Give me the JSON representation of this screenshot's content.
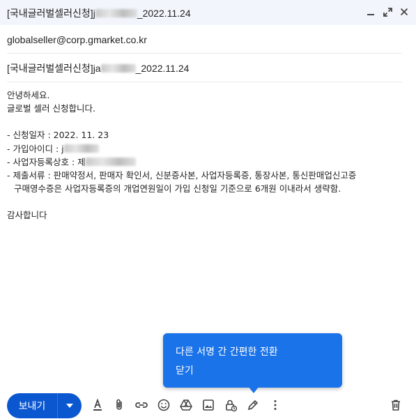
{
  "window": {
    "title_prefix": "[국내글러벌셀러신청]j",
    "title_suffix": "_2022.11.24"
  },
  "compose": {
    "to": "globalseller@corp.gmarket.co.kr",
    "subject_prefix": "[국내글러벌셀러신청]ja",
    "subject_suffix": "_2022.11.24"
  },
  "body": {
    "greeting": "안녕하세요.",
    "intro": "글로벌 셀러 신청합니다.",
    "date_line": "- 신청일자 : 2022. 11. 23",
    "id_label": "- 가입아이디 : j",
    "biz_label": "- 사업자등록상호 : 제",
    "docs_line1": "- 제출서류 : 판매약정서, 판매자 확인서, 신분증사본, 사업자등록증, 통장사본, 통신판매업신고증",
    "docs_line2": "구매영수증은 사업자등록증의 개업연원일이 가입 신청일 기준으로 6개원 이내라서 생략함.",
    "closing": "감사합니다"
  },
  "tooltip": {
    "text": "다른 서명 간 간편한 전환",
    "close": "닫기"
  },
  "toolbar": {
    "send_label": "보내기"
  },
  "colors": {
    "accent": "#0b57d0",
    "tooltip": "#1a73e8",
    "titlebar": "#f2f6fc"
  }
}
